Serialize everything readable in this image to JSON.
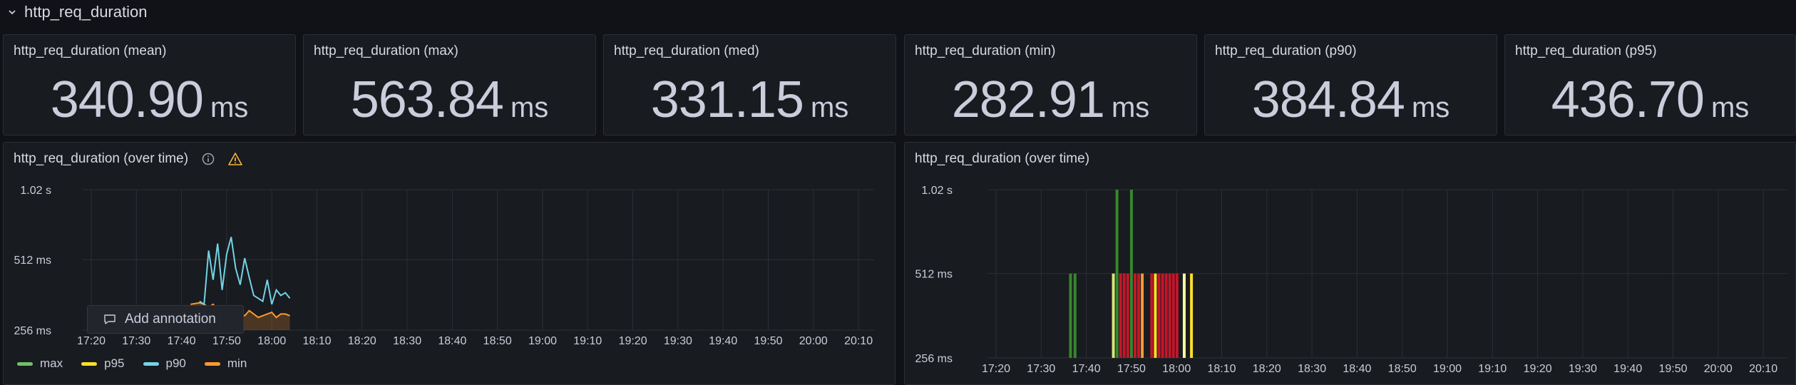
{
  "row": {
    "title": "http_req_duration",
    "icon": "chevron-down-icon"
  },
  "stats": [
    {
      "title": "http_req_duration (mean)",
      "value": "340.90",
      "unit": "ms"
    },
    {
      "title": "http_req_duration (max)",
      "value": "563.84",
      "unit": "ms"
    },
    {
      "title": "http_req_duration (med)",
      "value": "331.15",
      "unit": "ms"
    },
    {
      "title": "http_req_duration (min)",
      "value": "282.91",
      "unit": "ms"
    },
    {
      "title": "http_req_duration (p90)",
      "value": "384.84",
      "unit": "ms"
    },
    {
      "title": "http_req_duration (p95)",
      "value": "436.70",
      "unit": "ms"
    }
  ],
  "left_panel": {
    "title": "http_req_duration (over time)",
    "icons": [
      "info-icon",
      "warning-icon"
    ],
    "annotation_popup": {
      "label": "Add annotation",
      "icon": "comment-icon"
    },
    "legend": [
      {
        "name": "max",
        "color": "#73bf69"
      },
      {
        "name": "p95",
        "color": "#fade2a"
      },
      {
        "name": "p90",
        "color": "#8ab8ff"
      },
      {
        "name": "min",
        "color": "#ff9830"
      }
    ]
  },
  "right_panel": {
    "title": "http_req_duration (over time)"
  },
  "chart_data": [
    {
      "type": "line",
      "title": "http_req_duration (over time)",
      "y_scale": "log",
      "y_ticks": [
        "256 ms",
        "512 ms",
        "1.02 s"
      ],
      "x_ticks": [
        "17:20",
        "17:30",
        "17:40",
        "17:50",
        "18:00",
        "18:10",
        "18:20",
        "18:30",
        "18:40",
        "18:50",
        "19:00",
        "19:10",
        "19:20",
        "19:30",
        "19:40",
        "19:50",
        "20:00",
        "20:10"
      ],
      "grid": true,
      "legend_position": "bottom-left",
      "series": [
        {
          "name": "max",
          "color": "#73bf69"
        },
        {
          "name": "p95",
          "color": "#fade2a"
        },
        {
          "name": "p90",
          "color": "#73d3e6",
          "x": [
            "17:44",
            "17:45",
            "17:46",
            "17:47",
            "17:48",
            "17:49",
            "17:50",
            "17:51",
            "17:52",
            "17:53",
            "17:54",
            "17:55",
            "17:56",
            "17:57",
            "17:58",
            "17:59",
            "18:00",
            "18:01",
            "18:02",
            "18:03",
            "18:04"
          ],
          "y_ms": [
            340,
            330,
            560,
            420,
            600,
            380,
            540,
            640,
            470,
            400,
            520,
            430,
            360,
            350,
            340,
            420,
            330,
            380,
            360,
            370,
            350
          ]
        },
        {
          "name": "min",
          "color": "#ff9830",
          "x": [
            "17:42",
            "17:44",
            "17:45",
            "17:46",
            "17:47",
            "17:48",
            "17:49",
            "17:50",
            "17:51",
            "17:52",
            "17:53",
            "17:54",
            "17:55",
            "17:56",
            "17:57",
            "17:58",
            "17:59",
            "18:00",
            "18:01",
            "18:02",
            "18:03",
            "18:04"
          ],
          "y_ms": [
            330,
            335,
            330,
            320,
            330,
            310,
            320,
            300,
            305,
            315,
            300,
            295,
            310,
            300,
            290,
            295,
            300,
            305,
            290,
            300,
            300,
            295
          ]
        }
      ]
    },
    {
      "type": "bar",
      "title": "http_req_duration (over time)",
      "y_scale": "log",
      "y_ticks": [
        "256 ms",
        "512 ms",
        "1.02 s"
      ],
      "x_ticks": [
        "17:20",
        "17:30",
        "17:40",
        "17:50",
        "18:00",
        "18:10",
        "18:20",
        "18:30",
        "18:40",
        "18:50",
        "19:00",
        "19:10",
        "19:20",
        "19:30",
        "19:40",
        "19:50",
        "20:00",
        "20:10"
      ],
      "grid": true,
      "bars": [
        {
          "x": "17:36.5",
          "y_ms": 512,
          "color": "#37872d"
        },
        {
          "x": "17:37.5",
          "y_ms": 512,
          "color": "#37872d"
        },
        {
          "x": "17:46.0",
          "y_ms": 512,
          "color": "#d6e67a"
        },
        {
          "x": "17:46.8",
          "y_ms": 1020,
          "color": "#37872d"
        },
        {
          "x": "17:47.6",
          "y_ms": 512,
          "color": "#c4162a"
        },
        {
          "x": "17:48.4",
          "y_ms": 512,
          "color": "#c4162a"
        },
        {
          "x": "17:49.2",
          "y_ms": 512,
          "color": "#c4162a"
        },
        {
          "x": "17:50.0",
          "y_ms": 1020,
          "color": "#37872d"
        },
        {
          "x": "17:50.8",
          "y_ms": 512,
          "color": "#c4162a"
        },
        {
          "x": "17:51.6",
          "y_ms": 512,
          "color": "#c4162a"
        },
        {
          "x": "17:52.4",
          "y_ms": 512,
          "color": "#ff9830"
        },
        {
          "x": "17:54.5",
          "y_ms": 512,
          "color": "#c4162a"
        },
        {
          "x": "17:55.3",
          "y_ms": 512,
          "color": "#fade2a"
        },
        {
          "x": "17:56.1",
          "y_ms": 512,
          "color": "#c4162a"
        },
        {
          "x": "17:56.9",
          "y_ms": 512,
          "color": "#c4162a"
        },
        {
          "x": "17:57.7",
          "y_ms": 512,
          "color": "#c4162a"
        },
        {
          "x": "17:58.5",
          "y_ms": 512,
          "color": "#c4162a"
        },
        {
          "x": "17:59.3",
          "y_ms": 512,
          "color": "#c4162a"
        },
        {
          "x": "18:00.1",
          "y_ms": 512,
          "color": "#c4162a"
        },
        {
          "x": "18:01.7",
          "y_ms": 512,
          "color": "#fafa9c"
        },
        {
          "x": "18:03.3",
          "y_ms": 512,
          "color": "#fade2a"
        }
      ]
    }
  ]
}
